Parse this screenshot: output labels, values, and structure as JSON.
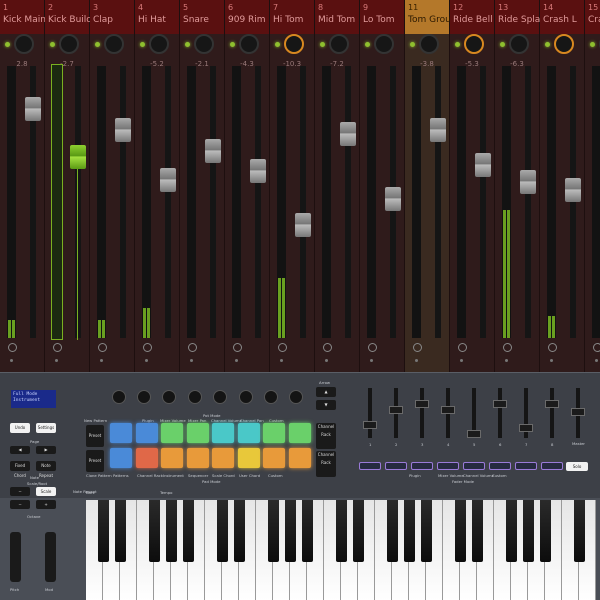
{
  "mixer": {
    "channels": [
      {
        "num": "1",
        "name": "Kick Main",
        "value": "2.8",
        "ring": false
      },
      {
        "num": "2",
        "name": "Kick Build",
        "value": "-2.7",
        "ring": false
      },
      {
        "num": "3",
        "name": "Clap",
        "value": "",
        "ring": false
      },
      {
        "num": "4",
        "name": "Hi Hat",
        "value": "-5.2",
        "ring": false
      },
      {
        "num": "5",
        "name": "Snare",
        "value": "-2.1",
        "ring": false
      },
      {
        "num": "6",
        "name": "909 Rim",
        "value": "-4.3",
        "ring": false
      },
      {
        "num": "7",
        "name": "Hi Tom",
        "value": "-10.3",
        "ring": true
      },
      {
        "num": "8",
        "name": "Mid Tom",
        "value": "-7.2",
        "ring": false
      },
      {
        "num": "9",
        "name": "Lo Tom",
        "value": "",
        "ring": false
      },
      {
        "num": "11",
        "name": "Tom Group",
        "value": "-3.8",
        "ring": false,
        "selected": true
      },
      {
        "num": "12",
        "name": "Ride Bell",
        "value": "-5.3",
        "ring": true
      },
      {
        "num": "13",
        "name": "Ride Splash",
        "value": "-6.3",
        "ring": false
      },
      {
        "num": "14",
        "name": "Crash L",
        "value": "",
        "ring": true
      },
      {
        "num": "15",
        "name": "Crash R",
        "value": "",
        "ring": false
      }
    ],
    "accent_color": "#7ab020",
    "header_color": "#5a1010",
    "selected_header_color": "#b4782a"
  },
  "device": {
    "display_lines": [
      "Full Mode",
      "Instrument"
    ],
    "labels": {
      "arrow": "Arrow",
      "new_pattern": "New Pattern",
      "plugin": "Plugin",
      "mixer_volume": "Mixer Volume",
      "mixer_pan": "Mixer Pan",
      "channel_volume": "Channel Volume",
      "channel_pan": "Channel Pan",
      "custom": "Custom",
      "pot_mode": "Pot Mode",
      "clone_pattern": "Clone Pattern",
      "patterns": "Patterns",
      "channel_rack_pad": "Channel Rack",
      "instrument": "Instrument",
      "sequencer": "Sequencer",
      "scale_chord": "Scale Chord",
      "user_chord": "User Chord",
      "custom_pad": "Custom",
      "pad_mode": "Pad Mode",
      "page": "Page",
      "note": "Note",
      "scale_root": "Scale/Root",
      "octave": "Octave",
      "note_repeat_top": "Note Repeat",
      "bars": "Bars",
      "tempo": "Tempo",
      "master": "Master",
      "plugin_fader": "Plugin",
      "mixer_volume_fader": "Mixer Volume",
      "channel_volume_fader": "Channel Volume",
      "custom_fader": "Custom",
      "fader_mode": "Fader Mode",
      "pitch": "Pitch",
      "mod": "Mod",
      "channel_rack_btn": "Channel Rack",
      "channel_rack_btn2": "Channel Rack"
    },
    "buttons": {
      "undo": "Undo",
      "settings": "Settings",
      "fixed_chord": "Fixed Chord",
      "note_repeat": "Note Repeat",
      "minus": "−",
      "plus": "+",
      "scale": "Scale",
      "solo": "Solo",
      "preset_up": "Preset",
      "preset_down": "Preset"
    },
    "fader_numbers": [
      "1",
      "2",
      "3",
      "4",
      "5",
      "6",
      "7",
      "8"
    ],
    "pad_colors_top": [
      "#4a8ad8",
      "#4a8ad8",
      "#6ad06a",
      "#6ad06a",
      "#4ac8c8",
      "#4ac8c8",
      "#6ad06a",
      "#6ad06a"
    ],
    "pad_colors_bottom": [
      "#4a8ad8",
      "#e06848",
      "#e89a3a",
      "#e89a3a",
      "#e89a3a",
      "#e8c83a",
      "#e89a3a",
      "#e89a3a"
    ],
    "tiny_numbers": [
      "16",
      "1/4",
      "1/8",
      "1/16",
      "1/32",
      "Triplet"
    ]
  }
}
